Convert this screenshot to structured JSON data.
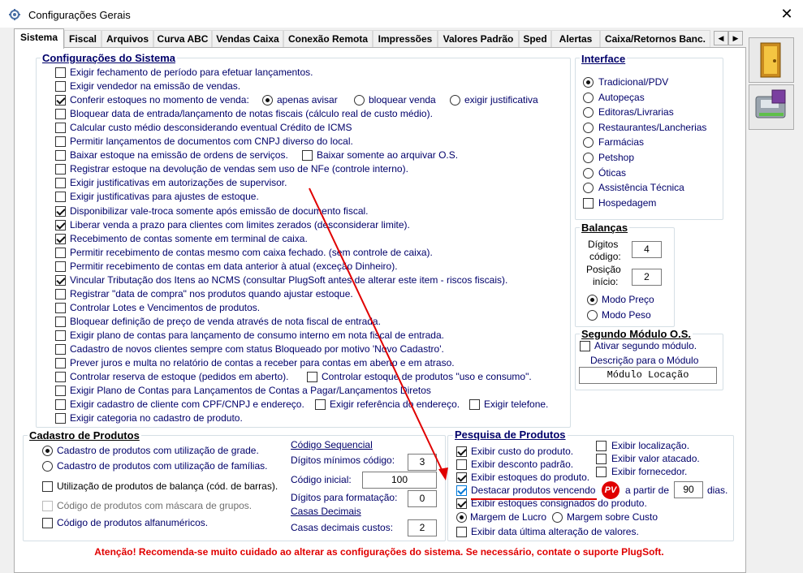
{
  "window": {
    "title": "Configurações Gerais",
    "close_glyph": "✕"
  },
  "tabs": [
    "Sistema",
    "Fiscal",
    "Arquivos",
    "Curva ABC",
    "Vendas Caixa",
    "Conexão Remota",
    "Impressões",
    "Valores Padrão",
    "Sped",
    "Alertas",
    "Caixa/Retornos Banc."
  ],
  "tab_scroll": {
    "left": "◀",
    "right": "▶"
  },
  "config_sistema": {
    "legend": "Configurações do Sistema",
    "items": [
      {
        "label": "Exigir fechamento de período para efetuar lançamentos.",
        "checked": false
      },
      {
        "label": "Exigir vendedor na emissão de vendas.",
        "checked": false
      },
      {
        "label": "Conferir estoques no momento de venda:",
        "checked": true
      },
      {
        "label": "Bloquear data de entrada/lançamento de notas fiscais (cálculo real de custo médio).",
        "checked": false
      },
      {
        "label": "Calcular custo médio desconsiderando eventual Crédito de ICMS",
        "checked": false
      },
      {
        "label": "Permitir lançamentos de documentos com CNPJ diverso do local.",
        "checked": false
      },
      {
        "label": "Baixar estoque na emissão de ordens de serviços.",
        "checked": false
      },
      {
        "label": "Registrar estoque na devolução de vendas sem uso de NFe (controle interno).",
        "checked": false
      },
      {
        "label": "Exigir justificativas em autorizações de supervisor.",
        "checked": false
      },
      {
        "label": "Exigir justificativas para ajustes de estoque.",
        "checked": false
      },
      {
        "label": "Disponibilizar vale-troca somente após emissão de documento fiscal.",
        "checked": true
      },
      {
        "label": "Liberar venda a prazo para clientes com limites zerados (desconsiderar limite).",
        "checked": true
      },
      {
        "label": "Recebimento de contas somente em terminal de caixa.",
        "checked": true
      },
      {
        "label": "Permitir recebimento de contas mesmo com caixa fechado. (sem controle de caixa).",
        "checked": false
      },
      {
        "label": "Permitir recebimento de contas em data anterior à atual (exceção Dinheiro).",
        "checked": false
      },
      {
        "label": "Vincular Tributação dos Itens ao NCMS (consultar PlugSoft antes de alterar este item - riscos fiscais).",
        "checked": true
      },
      {
        "label": "Registrar \"data de compra\" nos produtos quando  ajustar estoque.",
        "checked": false
      },
      {
        "label": "Controlar Lotes e Vencimentos de produtos.",
        "checked": false
      },
      {
        "label": "Bloquear definição de preço de venda através de nota fiscal de entrada.",
        "checked": false
      },
      {
        "label": "Exigir plano de contas para lançamento de consumo interno em nota fiscal de entrada.",
        "checked": false
      },
      {
        "label": "Cadastro de novos clientes sempre com status Bloqueado por motivo 'Novo Cadastro'.",
        "checked": false
      },
      {
        "label": "Prever juros e multa no relatório de contas a receber para contas em aberto e em atraso.",
        "checked": false
      },
      {
        "label": "Controlar reserva de estoque (pedidos em aberto).",
        "checked": false
      },
      {
        "label": "Exigir Plano de Contas para Lançamentos de Contas a Pagar/Lançamentos Diretos",
        "checked": false
      },
      {
        "label": "Exigir cadastro de cliente com CPF/CNPJ e endereço.",
        "checked": false
      },
      {
        "label": "Exigir categoria no cadastro de produto.",
        "checked": false
      }
    ],
    "estoque_options": [
      {
        "label": "apenas avisar",
        "selected": true
      },
      {
        "label": "bloquear venda",
        "selected": false
      },
      {
        "label": "exigir justificativa",
        "selected": false
      }
    ],
    "baixar_somente_os": {
      "label": "Baixar somente ao arquivar O.S.",
      "checked": false
    },
    "controlar_estoque_uso": {
      "label": "Controlar estoque de produtos \"uso e consumo\".",
      "checked": false
    },
    "exigir_referencia": {
      "label": "Exigir referência do endereço.",
      "checked": false
    },
    "exigir_telefone": {
      "label": "Exigir telefone.",
      "checked": false
    }
  },
  "interface": {
    "legend": "Interface",
    "options": [
      {
        "label": "Tradicional/PDV",
        "type": "radio",
        "selected": true
      },
      {
        "label": "Autopeças",
        "type": "radio",
        "selected": false
      },
      {
        "label": "Editoras/Livrarias",
        "type": "radio",
        "selected": false
      },
      {
        "label": "Restaurantes/Lancherias",
        "type": "radio",
        "selected": false
      },
      {
        "label": "Farmácias",
        "type": "radio",
        "selected": false
      },
      {
        "label": "Petshop",
        "type": "radio",
        "selected": false
      },
      {
        "label": "Óticas",
        "type": "radio",
        "selected": false
      },
      {
        "label": "Assistência Técnica",
        "type": "radio",
        "selected": false
      },
      {
        "label": "Hospedagem",
        "type": "checkbox",
        "selected": false
      }
    ]
  },
  "balancas": {
    "legend": "Balanças",
    "digitos_label_1": "Dígitos",
    "digitos_label_2": "código:",
    "digitos_value": "4",
    "posicao_label_1": "Posição",
    "posicao_label_2": "início:",
    "posicao_value": "2",
    "modes": [
      {
        "label": "Modo Preço",
        "selected": true
      },
      {
        "label": "Modo Peso",
        "selected": false
      }
    ]
  },
  "segundo_modulo": {
    "legend": "Segundo Módulo O.S.",
    "ativar_label": "Ativar segundo módulo.",
    "ativar_checked": false,
    "descricao_label": "Descrição para o Módulo",
    "descricao_value": "Módulo Locação"
  },
  "cadastro_produtos": {
    "legend": "Cadastro de Produtos",
    "radios": [
      {
        "label": "Cadastro de produtos com utilização de grade.",
        "selected": true
      },
      {
        "label": "Cadastro de produtos com utilização de famílias.",
        "selected": false
      }
    ],
    "checks": [
      {
        "label": "Utilização de produtos de balança (cód. de barras).",
        "checked": false,
        "disabled": false
      },
      {
        "label": "Código de produtos com máscara de grupos.",
        "checked": false,
        "disabled": true
      },
      {
        "label": "Código de produtos alfanuméricos.",
        "checked": false,
        "disabled": false
      }
    ],
    "codigo_sequencial_label": "Código Sequencial",
    "digitos_minimos_label": "Dígitos mínimos código:",
    "digitos_minimos_value": "3",
    "codigo_inicial_label": "Código inicial:",
    "codigo_inicial_value": "100",
    "digitos_formatacao_label": "Dígitos para formatação:",
    "digitos_formatacao_value": "0",
    "casas_decimais_link": "Casas Decimais",
    "casas_decimais_label": "Casas decimais custos:",
    "casas_decimais_value": "2"
  },
  "pesquisa_produtos": {
    "legend": "Pesquisa de Produtos",
    "left_checks": [
      {
        "label": "Exibir custo do produto.",
        "checked": true
      },
      {
        "label": "Exibir desconto padrão.",
        "checked": false
      },
      {
        "label": "Exibir estoques do produto.",
        "checked": true
      },
      {
        "label": "Destacar produtos vencendo",
        "checked": true
      },
      {
        "label": "Exibir estoques consignados do produto.",
        "checked": true
      }
    ],
    "right_checks": [
      {
        "label": "Exibir localização.",
        "checked": false
      },
      {
        "label": "Exibir valor atacado.",
        "checked": false
      },
      {
        "label": "Exibir fornecedor.",
        "checked": false
      }
    ],
    "pv_badge": "PV",
    "a_partir_label": "a partir de",
    "dias_value": "90",
    "dias_label": "dias.",
    "margem_options": [
      {
        "label": "Margem de Lucro",
        "selected": true
      },
      {
        "label": "Margem sobre Custo",
        "selected": false
      }
    ],
    "exibir_data_label": "Exibir data última alteração de valores.",
    "exibir_data_checked": false
  },
  "warning": "Atenção! Recomenda-se muito cuidado ao alterar as configurações do sistema. Se necessário, contate o suporte PlugSoft.",
  "side_buttons": [
    {
      "icon": "exit-door-icon"
    },
    {
      "icon": "save-disk-icon"
    }
  ]
}
